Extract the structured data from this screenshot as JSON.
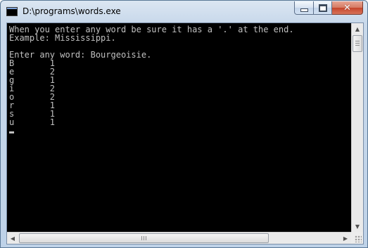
{
  "window": {
    "title": "D:\\programs\\words.exe",
    "icon": "console-app-icon",
    "buttons": {
      "minimize": "minimize-icon",
      "maximize": "maximize-icon",
      "close": "close-icon"
    }
  },
  "console": {
    "lines": [
      "When you enter any word be sure it has a '.' at the end.",
      "Example: Mississippi.",
      "",
      "Enter any word: Bourgeoisie.",
      "B       1",
      "e       2",
      "g       1",
      "i       2",
      "o       2",
      "r       1",
      "s       1",
      "u       1"
    ],
    "colors": {
      "background": "#000000",
      "text": "#c0c0c0"
    }
  }
}
